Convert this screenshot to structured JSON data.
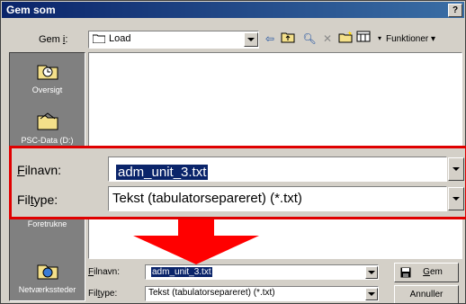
{
  "window": {
    "title": "Gem som",
    "help": "?"
  },
  "lookin": {
    "label_pre": "Gem ",
    "label_u": "i",
    "label_post": ":",
    "value": "Load"
  },
  "toolbar": {
    "functions_label": "Funktioner"
  },
  "places": [
    {
      "label": "Oversigt"
    },
    {
      "label": "PSC-Data (D:)"
    },
    {
      "label": "Foretrukne"
    },
    {
      "label": "Netværkssteder"
    }
  ],
  "filename": {
    "label_u": "F",
    "label_rest": "ilnavn:",
    "value": "adm_unit_3.txt"
  },
  "filetype": {
    "label_pre": "Fil",
    "label_u": "t",
    "label_post": "ype:",
    "value": "Tekst (tabulatorsepareret) (*.txt)"
  },
  "buttons": {
    "save_u": "G",
    "save_rest": "em",
    "cancel": "Annuller"
  },
  "colors": {
    "highlight": "#e00000",
    "arrow": "#ff0000",
    "titlebar": "#0a246a"
  }
}
